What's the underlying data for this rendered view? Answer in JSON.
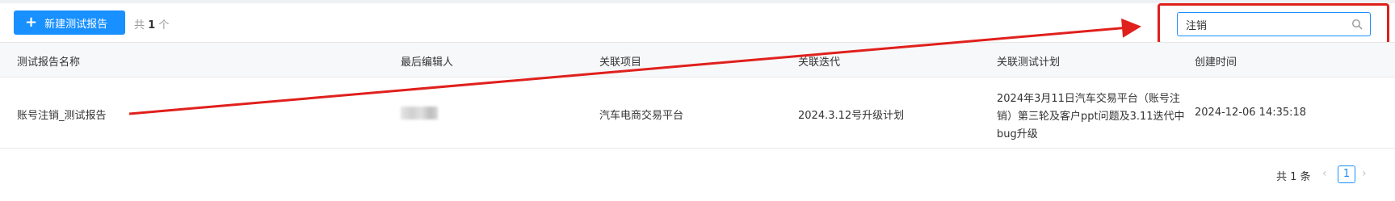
{
  "toolbar": {
    "new_button_icon": "plus-icon",
    "new_button_label": "新建测试报告",
    "count_prefix": "共",
    "count_value": "1",
    "count_suffix": "个"
  },
  "search": {
    "value": "注销",
    "icon": "search-icon",
    "accent": "#1890ff"
  },
  "annotation": {
    "color": "#e0201c"
  },
  "table": {
    "headers": [
      "测试报告名称",
      "最后编辑人",
      "关联项目",
      "关联迭代",
      "关联测试计划",
      "创建时间"
    ],
    "rows": [
      {
        "name": "账号注销_测试报告",
        "editor": "",
        "project": "汽车电商交易平台",
        "iteration": "2024.3.12号升级计划",
        "plan": "2024年3月11日汽车交易平台（账号注销）第三轮及客户ppt问题及3.11迭代中bug升级",
        "created": "2024-12-06 14:35:18"
      }
    ]
  },
  "pagination": {
    "total": "共 1 条",
    "current_page": "1",
    "prev_icon": "chevron-left-icon",
    "next_icon": "chevron-right-icon"
  }
}
